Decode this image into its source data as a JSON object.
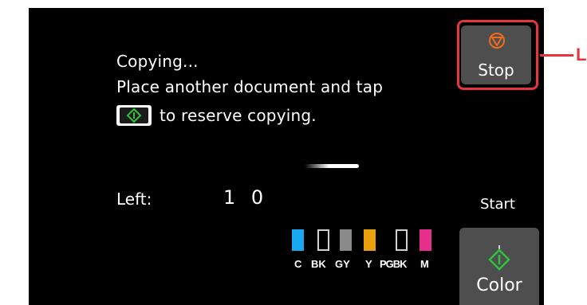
{
  "status": {
    "line1": "Copying...",
    "line2": "Place another document and tap",
    "line3": "to reserve copying."
  },
  "remaining": {
    "label": "Left:",
    "value": "1 0"
  },
  "ink_tanks": [
    {
      "label": "C",
      "color": "#19a9f0",
      "filled": true
    },
    {
      "label": "BK",
      "color": "#000000",
      "filled": false
    },
    {
      "label": "GY",
      "color": "#8a8a8a",
      "filled": true
    },
    {
      "label": "Y",
      "color": "#e8a10c",
      "filled": true
    },
    {
      "label": "PGBK",
      "color": "#000000",
      "filled": false
    },
    {
      "label": "M",
      "color": "#e62e8b",
      "filled": true
    }
  ],
  "buttons": {
    "stop_label": "Stop",
    "start_label": "Start",
    "color_label": "Color"
  },
  "callout": {
    "letter": "L",
    "color": "#e8343d"
  },
  "icons": {
    "stop": "stop-icon",
    "start": "start-diamond-icon"
  },
  "colors": {
    "screen_bg": "#000000",
    "button_bg": "#4e4e4e",
    "stop_orange": "#f26b1d",
    "start_green": "#2ec33c"
  }
}
